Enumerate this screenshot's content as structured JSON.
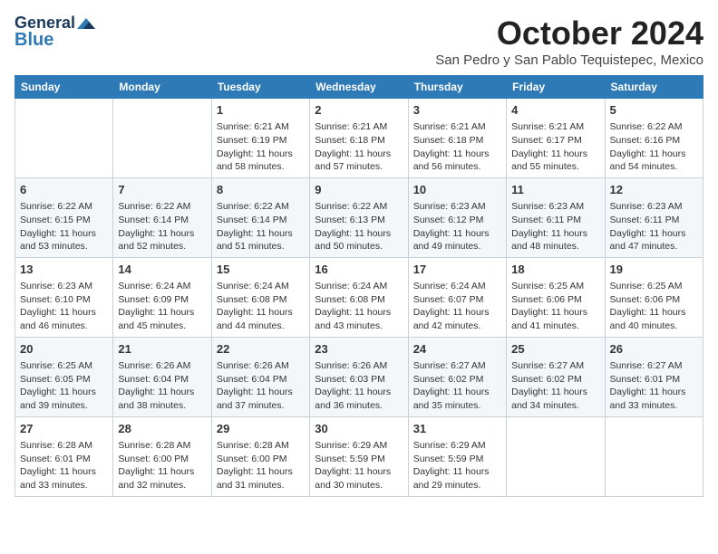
{
  "header": {
    "logo_general": "General",
    "logo_blue": "Blue",
    "month_title": "October 2024",
    "location": "San Pedro y San Pablo Tequistepec, Mexico"
  },
  "days_of_week": [
    "Sunday",
    "Monday",
    "Tuesday",
    "Wednesday",
    "Thursday",
    "Friday",
    "Saturday"
  ],
  "weeks": [
    [
      {
        "day": "",
        "content": ""
      },
      {
        "day": "",
        "content": ""
      },
      {
        "day": "1",
        "content": "Sunrise: 6:21 AM\nSunset: 6:19 PM\nDaylight: 11 hours and 58 minutes."
      },
      {
        "day": "2",
        "content": "Sunrise: 6:21 AM\nSunset: 6:18 PM\nDaylight: 11 hours and 57 minutes."
      },
      {
        "day": "3",
        "content": "Sunrise: 6:21 AM\nSunset: 6:18 PM\nDaylight: 11 hours and 56 minutes."
      },
      {
        "day": "4",
        "content": "Sunrise: 6:21 AM\nSunset: 6:17 PM\nDaylight: 11 hours and 55 minutes."
      },
      {
        "day": "5",
        "content": "Sunrise: 6:22 AM\nSunset: 6:16 PM\nDaylight: 11 hours and 54 minutes."
      }
    ],
    [
      {
        "day": "6",
        "content": "Sunrise: 6:22 AM\nSunset: 6:15 PM\nDaylight: 11 hours and 53 minutes."
      },
      {
        "day": "7",
        "content": "Sunrise: 6:22 AM\nSunset: 6:14 PM\nDaylight: 11 hours and 52 minutes."
      },
      {
        "day": "8",
        "content": "Sunrise: 6:22 AM\nSunset: 6:14 PM\nDaylight: 11 hours and 51 minutes."
      },
      {
        "day": "9",
        "content": "Sunrise: 6:22 AM\nSunset: 6:13 PM\nDaylight: 11 hours and 50 minutes."
      },
      {
        "day": "10",
        "content": "Sunrise: 6:23 AM\nSunset: 6:12 PM\nDaylight: 11 hours and 49 minutes."
      },
      {
        "day": "11",
        "content": "Sunrise: 6:23 AM\nSunset: 6:11 PM\nDaylight: 11 hours and 48 minutes."
      },
      {
        "day": "12",
        "content": "Sunrise: 6:23 AM\nSunset: 6:11 PM\nDaylight: 11 hours and 47 minutes."
      }
    ],
    [
      {
        "day": "13",
        "content": "Sunrise: 6:23 AM\nSunset: 6:10 PM\nDaylight: 11 hours and 46 minutes."
      },
      {
        "day": "14",
        "content": "Sunrise: 6:24 AM\nSunset: 6:09 PM\nDaylight: 11 hours and 45 minutes."
      },
      {
        "day": "15",
        "content": "Sunrise: 6:24 AM\nSunset: 6:08 PM\nDaylight: 11 hours and 44 minutes."
      },
      {
        "day": "16",
        "content": "Sunrise: 6:24 AM\nSunset: 6:08 PM\nDaylight: 11 hours and 43 minutes."
      },
      {
        "day": "17",
        "content": "Sunrise: 6:24 AM\nSunset: 6:07 PM\nDaylight: 11 hours and 42 minutes."
      },
      {
        "day": "18",
        "content": "Sunrise: 6:25 AM\nSunset: 6:06 PM\nDaylight: 11 hours and 41 minutes."
      },
      {
        "day": "19",
        "content": "Sunrise: 6:25 AM\nSunset: 6:06 PM\nDaylight: 11 hours and 40 minutes."
      }
    ],
    [
      {
        "day": "20",
        "content": "Sunrise: 6:25 AM\nSunset: 6:05 PM\nDaylight: 11 hours and 39 minutes."
      },
      {
        "day": "21",
        "content": "Sunrise: 6:26 AM\nSunset: 6:04 PM\nDaylight: 11 hours and 38 minutes."
      },
      {
        "day": "22",
        "content": "Sunrise: 6:26 AM\nSunset: 6:04 PM\nDaylight: 11 hours and 37 minutes."
      },
      {
        "day": "23",
        "content": "Sunrise: 6:26 AM\nSunset: 6:03 PM\nDaylight: 11 hours and 36 minutes."
      },
      {
        "day": "24",
        "content": "Sunrise: 6:27 AM\nSunset: 6:02 PM\nDaylight: 11 hours and 35 minutes."
      },
      {
        "day": "25",
        "content": "Sunrise: 6:27 AM\nSunset: 6:02 PM\nDaylight: 11 hours and 34 minutes."
      },
      {
        "day": "26",
        "content": "Sunrise: 6:27 AM\nSunset: 6:01 PM\nDaylight: 11 hours and 33 minutes."
      }
    ],
    [
      {
        "day": "27",
        "content": "Sunrise: 6:28 AM\nSunset: 6:01 PM\nDaylight: 11 hours and 33 minutes."
      },
      {
        "day": "28",
        "content": "Sunrise: 6:28 AM\nSunset: 6:00 PM\nDaylight: 11 hours and 32 minutes."
      },
      {
        "day": "29",
        "content": "Sunrise: 6:28 AM\nSunset: 6:00 PM\nDaylight: 11 hours and 31 minutes."
      },
      {
        "day": "30",
        "content": "Sunrise: 6:29 AM\nSunset: 5:59 PM\nDaylight: 11 hours and 30 minutes."
      },
      {
        "day": "31",
        "content": "Sunrise: 6:29 AM\nSunset: 5:59 PM\nDaylight: 11 hours and 29 minutes."
      },
      {
        "day": "",
        "content": ""
      },
      {
        "day": "",
        "content": ""
      }
    ]
  ]
}
